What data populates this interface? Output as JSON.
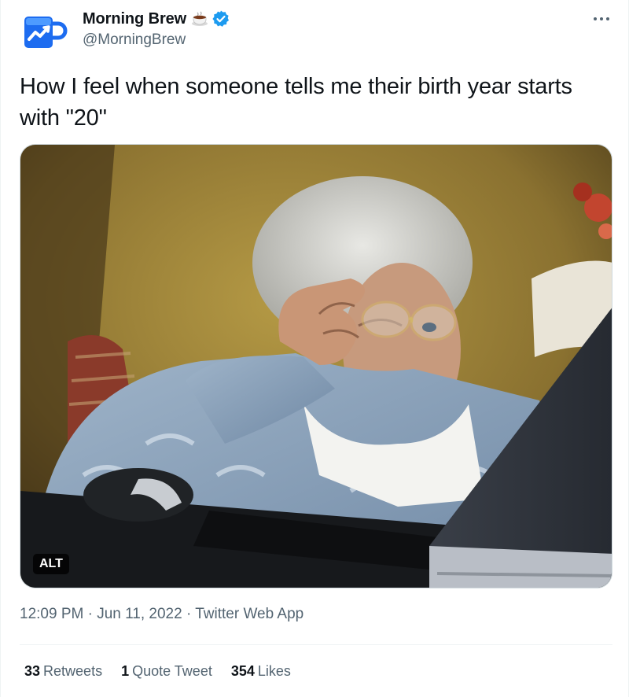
{
  "author": {
    "display_name": "Morning Brew",
    "handle": "@MorningBrew",
    "badge_emoji": "coffee-icon",
    "verified": true,
    "avatar_icon": "mug-chart-icon",
    "accent_color": "#1d9bf0"
  },
  "tweet": {
    "text": "How I feel when someone tells me their birth year starts with \"20\""
  },
  "media": {
    "alt_label": "ALT"
  },
  "meta": {
    "time": "12:09 PM",
    "separator1": "·",
    "date": "Jun 11, 2022",
    "separator2": "·",
    "source": "Twitter Web App"
  },
  "stats": {
    "retweets_count": "33",
    "retweets_label": "Retweets",
    "quotes_count": "1",
    "quotes_label": "Quote Tweet",
    "likes_count": "354",
    "likes_label": "Likes"
  },
  "colors": {
    "text_primary": "#0f1419",
    "text_secondary": "#536471",
    "verified_blue": "#1d9bf0",
    "border": "#eff3f4"
  }
}
